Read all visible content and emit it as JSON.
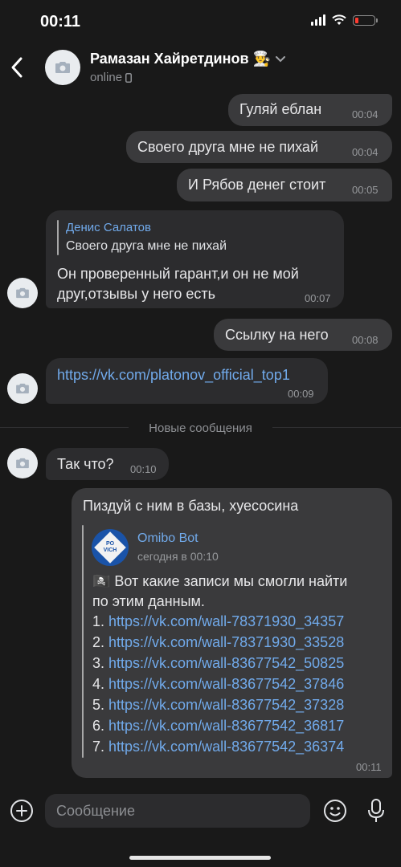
{
  "status_bar": {
    "time": "00:11"
  },
  "header": {
    "name": "Рамазан Хайретдинов 👨‍🍳",
    "status": "online"
  },
  "messages": {
    "m1": {
      "text": "Гуляй еблан",
      "time": "00:04"
    },
    "m2": {
      "text": "Своего друга мне не пихай",
      "time": "00:04"
    },
    "m3": {
      "text": "И Рябов денег стоит",
      "time": "00:05"
    },
    "m4": {
      "reply_author": "Денис Салатов",
      "reply_text": "Своего друга мне не пихай",
      "line1": "Он проверенный гарант,и он не мой",
      "line2": "друг,отзывы у него есть",
      "time": "00:07"
    },
    "m5": {
      "text": "Ссылку на него",
      "time": "00:08"
    },
    "m6": {
      "text": "https://vk.com/platonov_official_top1",
      "time": "00:09"
    },
    "divider": "Новые сообщения",
    "m7": {
      "text": "Так что?",
      "time": "00:10"
    },
    "m8": {
      "text": "Пиздуй с ним в базы, хуесосина",
      "forward_author": "Omibo Bot",
      "forward_time": "сегодня в 00:10",
      "bot_logo": "PO VICH",
      "intro1": "🏴‍☠️ Вот какие записи мы смогли найти",
      "intro2": "по этим данным.",
      "items": [
        {
          "num": "1.",
          "url": "https://vk.com/wall-78371930_34357"
        },
        {
          "num": "2.",
          "url": "https://vk.com/wall-78371930_33528"
        },
        {
          "num": "3.",
          "url": "https://vk.com/wall-83677542_50825"
        },
        {
          "num": "4.",
          "url": "https://vk.com/wall-83677542_37846"
        },
        {
          "num": "5.",
          "url": "https://vk.com/wall-83677542_37328"
        },
        {
          "num": "6.",
          "url": "https://vk.com/wall-83677542_36817"
        },
        {
          "num": "7.",
          "url": "https://vk.com/wall-83677542_36374"
        }
      ],
      "time": "00:11"
    }
  },
  "composer": {
    "placeholder": "Сообщение"
  },
  "icons": {
    "back": "chevron-left-icon",
    "camera": "camera-icon",
    "add": "plus-circle-icon",
    "emoji": "smile-icon",
    "mic": "microphone-icon"
  },
  "colors": {
    "background": "#191919",
    "bubble": "#2c2c2e",
    "link": "#71aaeb",
    "meta": "#97999c"
  }
}
